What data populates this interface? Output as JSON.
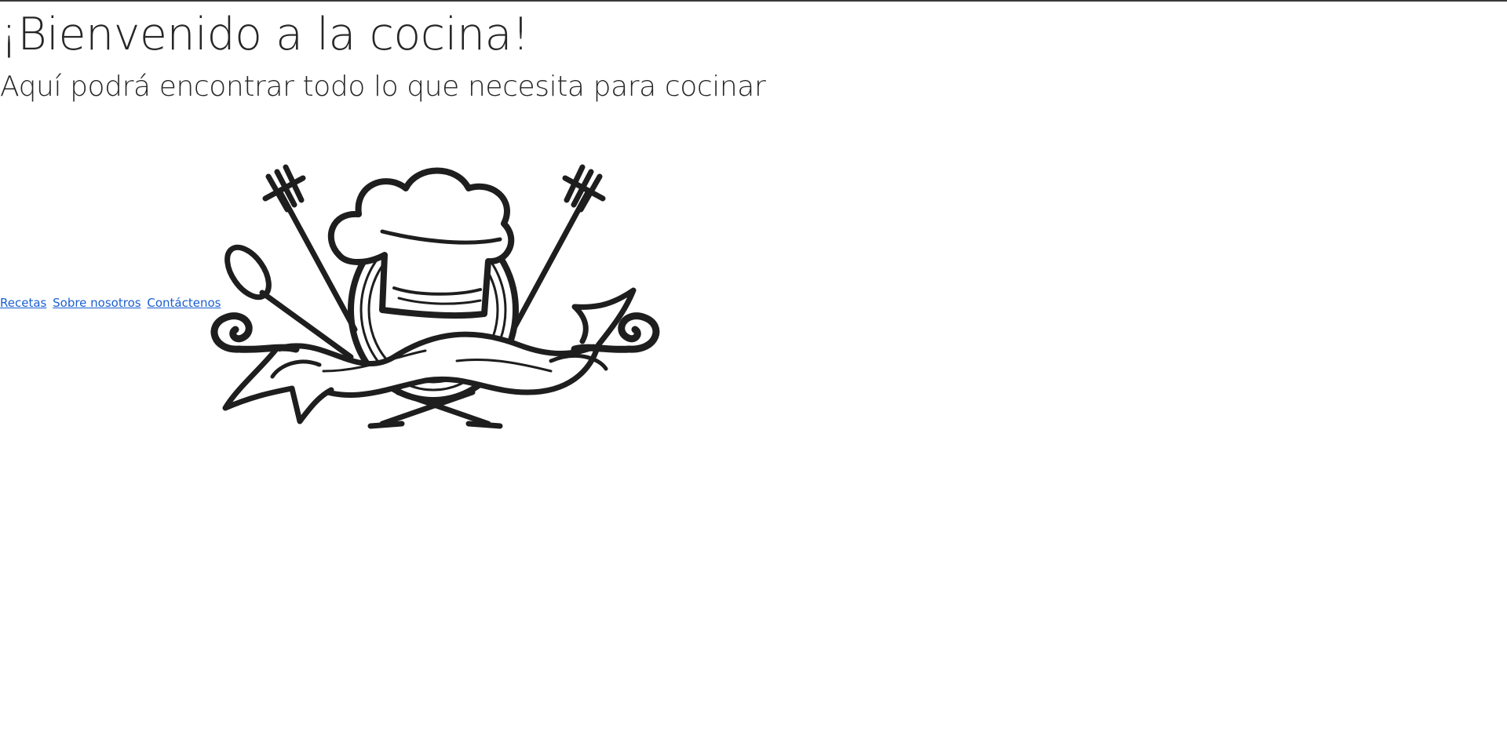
{
  "header": {
    "title": "¡Bienvenido a la cocina!",
    "subtitle": "Aquí podrá encontrar todo lo que necesita para cocinar"
  },
  "nav": {
    "links": [
      {
        "label": "Recetas"
      },
      {
        "label": "Sobre nosotros"
      },
      {
        "label": "Contáctenos"
      }
    ]
  },
  "logo": {
    "icon": "chef-hat-fork-spoon-ribbon-logo",
    "ink_color": "#1e1e1e"
  },
  "colors": {
    "link": "#1a5fd0",
    "text": "#262626",
    "background": "#ffffff"
  }
}
